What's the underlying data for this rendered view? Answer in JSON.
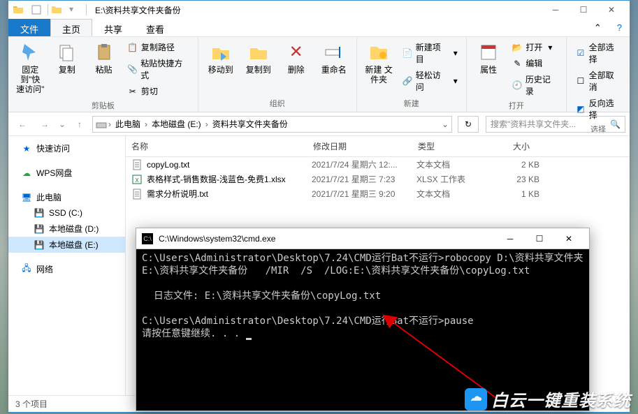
{
  "window": {
    "title": "E:\\资料共享文件夹备份"
  },
  "tabs": {
    "file": "文件",
    "home": "主页",
    "share": "共享",
    "view": "查看"
  },
  "ribbon": {
    "pin": "固定到\"快\n速访问\"",
    "copy": "复制",
    "paste": "粘贴",
    "copy_path": "复制路径",
    "paste_shortcut": "粘贴快捷方式",
    "cut": "剪切",
    "group_clipboard": "剪贴板",
    "move_to": "移动到",
    "copy_to": "复制到",
    "delete": "删除",
    "rename": "重命名",
    "group_organize": "组织",
    "new_folder": "新建\n文件夹",
    "new_item": "新建项目",
    "easy_access": "轻松访问",
    "group_new": "新建",
    "properties": "属性",
    "open": "打开",
    "edit": "编辑",
    "history": "历史记录",
    "group_open": "打开",
    "select_all": "全部选择",
    "select_none": "全部取消",
    "invert": "反向选择",
    "group_select": "选择"
  },
  "nav": {
    "search_placeholder": "搜索\"资料共享文件夹..."
  },
  "breadcrumb": [
    "此电脑",
    "本地磁盘 (E:)",
    "资料共享文件夹备份"
  ],
  "navpane": {
    "quick": "快速访问",
    "wps": "WPS网盘",
    "thispc": "此电脑",
    "ssd": "SSD (C:)",
    "disk_d": "本地磁盘 (D:)",
    "disk_e": "本地磁盘 (E:)",
    "network": "网络"
  },
  "columns": {
    "name": "名称",
    "date": "修改日期",
    "type": "类型",
    "size": "大小"
  },
  "files": [
    {
      "name": "copyLog.txt",
      "date": "2021/7/24 星期六 12:...",
      "type": "文本文档",
      "size": "2 KB",
      "icon": "txt"
    },
    {
      "name": "表格样式-销售数据-浅蓝色-免费1.xlsx",
      "date": "2021/7/21 星期三 7:23",
      "type": "XLSX 工作表",
      "size": "23 KB",
      "icon": "xlsx"
    },
    {
      "name": "需求分析说明.txt",
      "date": "2021/7/21 星期三 9:20",
      "type": "文本文档",
      "size": "1 KB",
      "icon": "txt"
    }
  ],
  "status": {
    "items": "3 个项目"
  },
  "cmd": {
    "title": "C:\\Windows\\system32\\cmd.exe",
    "lines": [
      "C:\\Users\\Administrator\\Desktop\\7.24\\CMD运行Bat不运行>robocopy D:\\资料共享文件夹  E:\\资料共享文件夹备份   /MIR  /S  /LOG:E:\\资料共享文件夹备份\\copyLog.txt",
      "",
      "  日志文件: E:\\资料共享文件夹备份\\copyLog.txt",
      "",
      "C:\\Users\\Administrator\\Desktop\\7.24\\CMD运行Bat不运行>pause",
      "请按任意键继续. . . "
    ]
  },
  "watermark": "白云一键重装系统"
}
